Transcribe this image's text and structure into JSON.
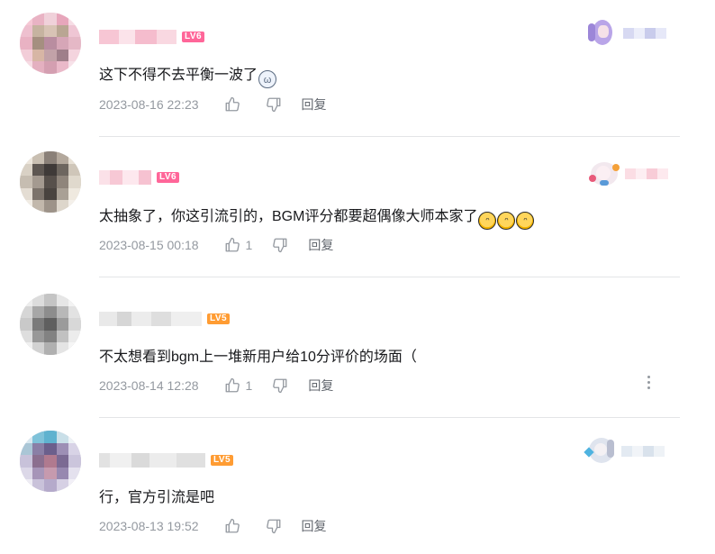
{
  "colors": {
    "lv6": "#ff6699",
    "lv5": "#ff9c33",
    "meta": "#9499a0",
    "divider": "#e3e5e7"
  },
  "comments": [
    {
      "level": "LV6",
      "content": "这下不得不去平衡一波了",
      "emoji": [
        "cat-icon"
      ],
      "time": "2023-08-16 22:23",
      "likes": "",
      "reply": "回复"
    },
    {
      "level": "LV6",
      "content": "太抽象了，你这引流引的，BGM评分都要超偶像大师本家了",
      "emoji": [
        "sweat-smile-icon",
        "sweat-smile-icon",
        "sweat-smile-icon"
      ],
      "time": "2023-08-15 00:18",
      "likes": "1",
      "reply": "回复"
    },
    {
      "level": "LV5",
      "content": "不太想看到bgm上一堆新用户给10分评价的场面（",
      "emoji": [],
      "time": "2023-08-14 12:28",
      "likes": "1",
      "reply": "回复"
    },
    {
      "level": "LV5",
      "content": "行，官方引流是吧",
      "emoji": [],
      "time": "2023-08-13 19:52",
      "likes": "",
      "reply": "回复"
    }
  ]
}
